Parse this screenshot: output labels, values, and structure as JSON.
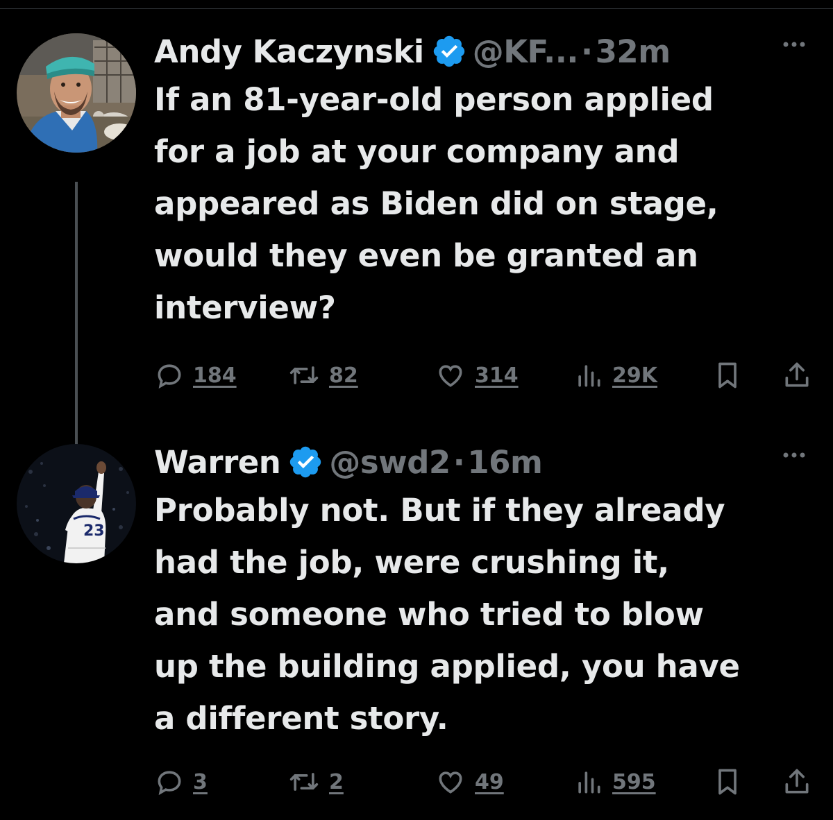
{
  "theme": {
    "background": "#000000",
    "text": "#e7e9ea",
    "muted": "#71767b",
    "verified_blue": "#1d9bf0"
  },
  "tweets": [
    {
      "display_name": "Andy Kaczynski",
      "verified": true,
      "handle": "@KF...",
      "separator": "·",
      "time": "32m",
      "text_lines": [
        "If an 81-year-old person applied",
        "for a job at your company and",
        "appeared as Biden did on stage,",
        "would they even be granted an",
        "interview?"
      ],
      "replies": "184",
      "reposts": "82",
      "likes": "314",
      "views": "29K",
      "icons": [
        "reply-icon",
        "repost-icon",
        "like-icon",
        "views-icon",
        "bookmark-icon",
        "share-icon"
      ]
    },
    {
      "display_name": "Warren",
      "verified": true,
      "handle": "@swd2",
      "separator": "·",
      "time": "16m",
      "jersey_number": "23",
      "text_lines": [
        "Probably not. But if they already",
        "had the job, were crushing it,",
        "and someone who tried to blow",
        "up the building applied, you have",
        "a different story."
      ],
      "replies": "3",
      "reposts": "2",
      "likes": "49",
      "views": "595",
      "icons": [
        "reply-icon",
        "repost-icon",
        "like-icon",
        "views-icon",
        "bookmark-icon",
        "share-icon"
      ]
    }
  ]
}
